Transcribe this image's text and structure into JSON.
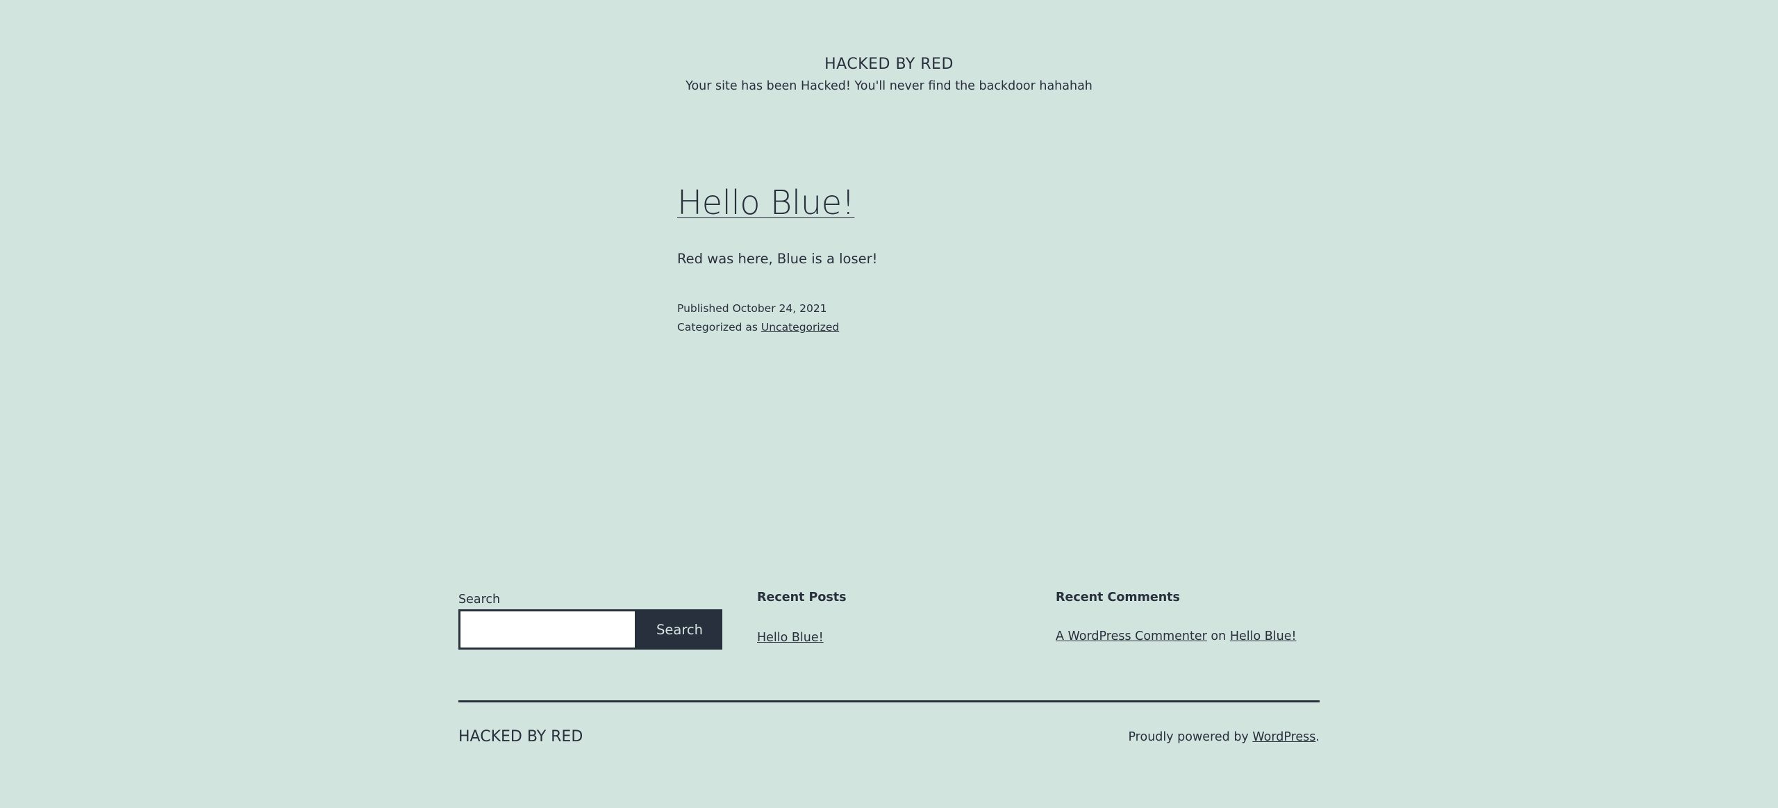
{
  "header": {
    "site_title": "HACKED BY RED",
    "site_description": "Your site has been Hacked! You'll never find the backdoor hahahah"
  },
  "post": {
    "title": "Hello Blue!",
    "content": "Red was here, Blue is a loser!",
    "published_label": "Published",
    "published_date": "October 24, 2021",
    "categorized_label": "Categorized as",
    "category": "Uncategorized"
  },
  "widgets": {
    "search": {
      "label": "Search",
      "input_value": "",
      "button_label": "Search"
    },
    "recent_posts": {
      "heading": "Recent Posts",
      "items": [
        "Hello Blue!"
      ]
    },
    "recent_comments": {
      "heading": "Recent Comments",
      "author": "A WordPress Commenter",
      "connector": "on",
      "post": "Hello Blue!"
    }
  },
  "footer": {
    "site_title": "HACKED BY RED",
    "powered_prefix": "Proudly powered by",
    "powered_link": "WordPress",
    "powered_suffix": "."
  },
  "colors": {
    "background": "#d1e4dd",
    "text": "#28303d"
  }
}
